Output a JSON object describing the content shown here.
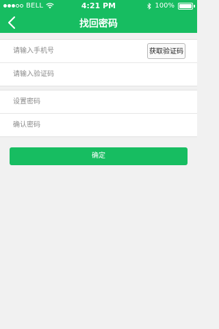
{
  "status_bar": {
    "carrier": "BELL",
    "time": "4:21 PM",
    "battery": "100%",
    "signal_icon": "signal-dots-icon",
    "wifi_icon": "wifi-icon",
    "bluetooth_icon": "bluetooth-icon",
    "battery_icon": "battery-icon"
  },
  "nav": {
    "title": "找回密码",
    "back_icon": "chevron-left-icon"
  },
  "form": {
    "phone_placeholder": "请输入手机号",
    "get_code_label": "获取验证码",
    "code_placeholder": "请输入验证码",
    "password_placeholder": "设置密码",
    "confirm_password_placeholder": "确认密码"
  },
  "actions": {
    "submit_label": "确定"
  },
  "colors": {
    "accent": "#17bd61",
    "background": "#f1f1f1"
  }
}
